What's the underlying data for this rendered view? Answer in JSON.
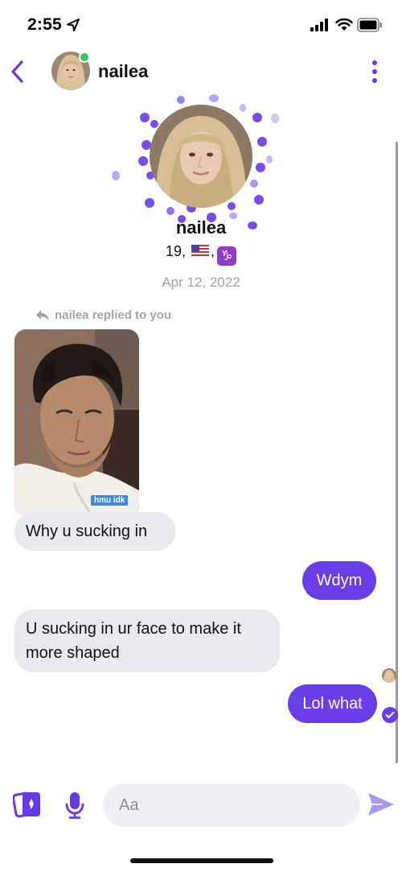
{
  "status_bar": {
    "time": "2:55",
    "location_icon": "location-arrow-icon",
    "signal_icon": "cellular-signal-icon",
    "wifi_icon": "wifi-icon",
    "battery_icon": "battery-icon"
  },
  "header": {
    "back_icon": "chevron-left-icon",
    "name": "nailea",
    "online": true,
    "more_icon": "vertical-ellipsis-icon"
  },
  "profile": {
    "name": "nailea",
    "age": "19,",
    "flag_icon": "us-flag-icon",
    "separator": ",",
    "zodiac": "♑",
    "zodiac_icon": "capricorn-icon"
  },
  "thread": {
    "date": "Apr 12, 2022",
    "reply_note": "nailea replied to you",
    "snap_caption": "hmu idk",
    "messages": [
      {
        "direction": "in",
        "text": "Why u sucking in"
      },
      {
        "direction": "out",
        "text": "Wdym"
      },
      {
        "direction": "in",
        "text": "U sucking in ur face to make it more shaped"
      },
      {
        "direction": "out",
        "text": "Lol what"
      }
    ]
  },
  "composer": {
    "cards_icon": "photo-cards-icon",
    "mic_icon": "microphone-icon",
    "placeholder": "Aa",
    "send_icon": "send-arrow-icon"
  },
  "colors": {
    "accent": "#6a3ee6",
    "incoming_bubble": "#e9e9ee",
    "online": "#35c65a",
    "muted_text": "#a2a2a6"
  }
}
